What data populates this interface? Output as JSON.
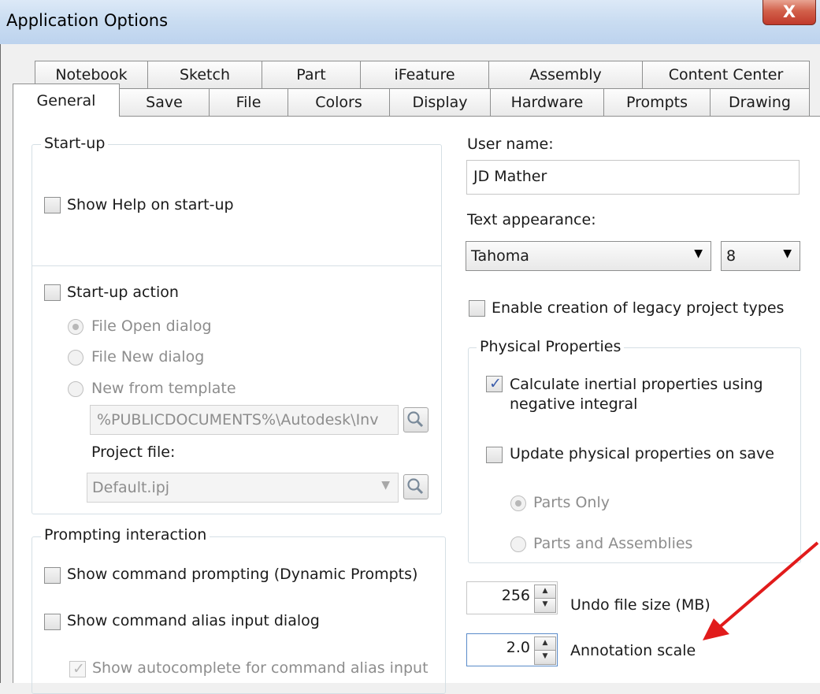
{
  "window": {
    "title": "Application Options",
    "close_symbol": "X"
  },
  "tabs_row1": [
    "Notebook",
    "Sketch",
    "Part",
    "iFeature",
    "Assembly",
    "Content Center"
  ],
  "tabs_row2": [
    "General",
    "Save",
    "File",
    "Colors",
    "Display",
    "Hardware",
    "Prompts",
    "Drawing"
  ],
  "startup": {
    "legend": "Start-up",
    "show_help": "Show Help on start-up",
    "startup_action": "Start-up action",
    "file_open": "File Open dialog",
    "file_new": "File New dialog",
    "new_template": "New from template",
    "template_path": "%PUBLICDOCUMENTS%\\Autodesk\\Inv",
    "project_label": "Project file:",
    "project_value": "Default.ipj"
  },
  "prompting": {
    "legend": "Prompting interaction",
    "dynamic_prompts": "Show command prompting (Dynamic Prompts)",
    "alias_dialog": "Show command alias input dialog",
    "autocomplete": "Show autocomplete for command alias input"
  },
  "user": {
    "label": "User name:",
    "value": "JD Mather"
  },
  "text_appearance": {
    "label": "Text appearance:",
    "font": "Tahoma",
    "size": "8"
  },
  "legacy": "Enable creation of legacy project types",
  "physical": {
    "legend": "Physical Properties",
    "calc_line1": "Calculate inertial properties using",
    "calc_line2": "negative integral",
    "update_on_save": "Update physical properties on save",
    "parts_only": "Parts Only",
    "parts_assemblies": "Parts and Assemblies"
  },
  "undo": {
    "value": "256",
    "label": "Undo file size (MB)"
  },
  "annotation": {
    "value": "2.0",
    "label": "Annotation scale"
  },
  "colors": {
    "arrow": "#e11b1b",
    "check": "#3b5dab"
  }
}
